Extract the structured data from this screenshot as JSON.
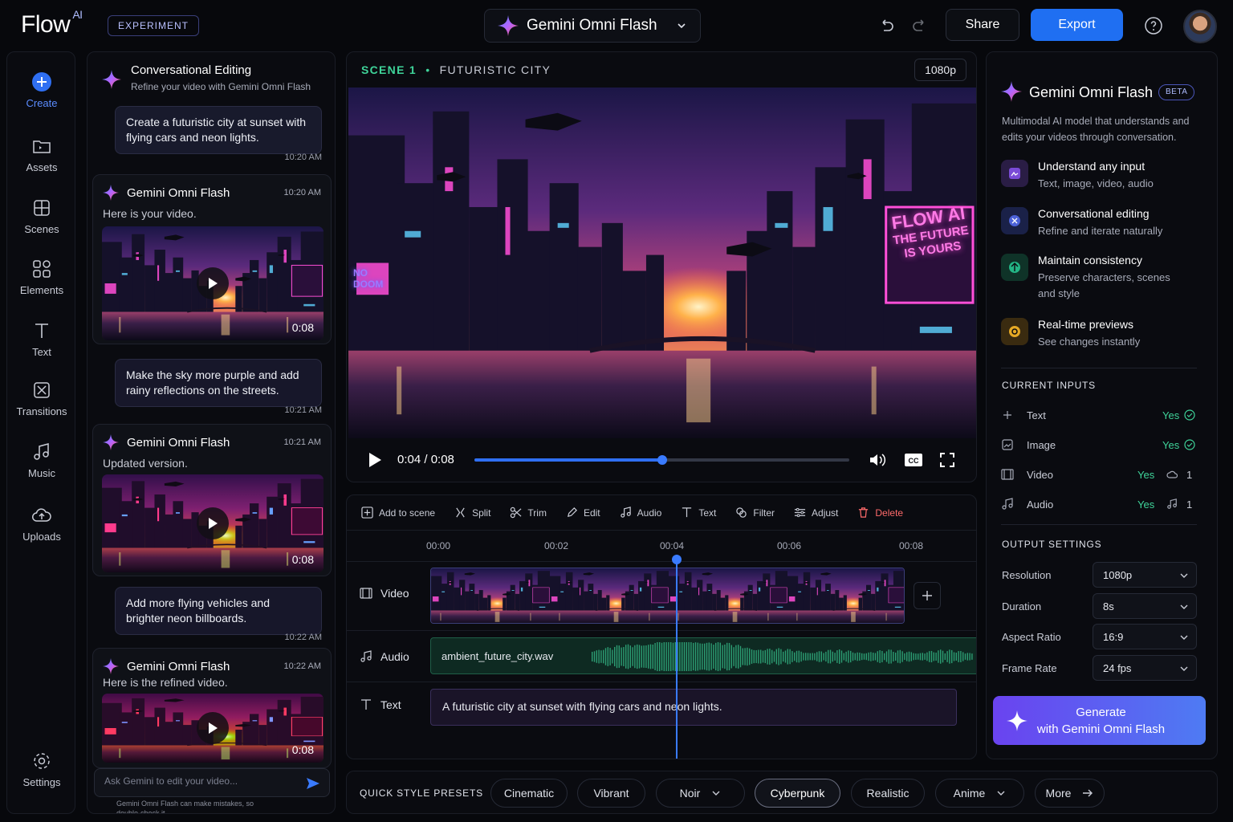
{
  "app": {
    "logo": "Flow",
    "logo_sup": "AI",
    "badge": "EXPERIMENT"
  },
  "header": {
    "model": "Gemini Omni Flash",
    "share": "Share",
    "export": "Export"
  },
  "rail": [
    {
      "label": "Create",
      "icon": "plus-circle-icon"
    },
    {
      "label": "Assets",
      "icon": "folder-icon"
    },
    {
      "label": "Scenes",
      "icon": "scenes-icon"
    },
    {
      "label": "Elements",
      "icon": "elements-icon"
    },
    {
      "label": "Text",
      "icon": "text-icon"
    },
    {
      "label": "Transitions",
      "icon": "transition-icon"
    },
    {
      "label": "Music",
      "icon": "music-icon"
    },
    {
      "label": "Uploads",
      "icon": "upload-cloud-icon"
    },
    {
      "label": "Settings",
      "icon": "gear-icon"
    }
  ],
  "chat": {
    "title": "Conversational Editing",
    "subtitle": "Refine your video with Gemini Omni Flash",
    "messages": [
      {
        "user": "Create a futuristic city at sunset with flying cars and neon lights.",
        "user_time": "10:20 AM",
        "ai_name": "Gemini Omni Flash",
        "ai_time": "10:20 AM",
        "ai_text": "Here is your video.",
        "duration": "0:08"
      },
      {
        "user": "Make the sky more purple and add rainy reflections on the streets.",
        "user_time": "10:21 AM",
        "ai_name": "Gemini Omni Flash",
        "ai_time": "10:21 AM",
        "ai_text": "Updated version.",
        "duration": "0:08"
      },
      {
        "user": "Add more flying vehicles and brighter neon billboards.",
        "user_time": "10:22 AM",
        "ai_name": "Gemini Omni Flash",
        "ai_time": "10:22 AM",
        "ai_text": "Here is the refined video.",
        "duration": "0:08"
      }
    ],
    "input_placeholder": "Ask Gemini to edit your video...",
    "disclaimer": "Gemini Omni Flash can make mistakes, so double-check it."
  },
  "preview": {
    "scene_num": "SCENE 1",
    "scene_sep": "•",
    "scene_name": "FUTURISTIC CITY",
    "resolution": "1080p",
    "time": "0:04 / 0:08",
    "progress": 0.5,
    "billboard_1": "FLOW AI",
    "billboard_2": "THE FUTURE",
    "billboard_3": "IS YOURS",
    "sign_left": "NO DOOM"
  },
  "toolbar": [
    "Add to scene",
    "Split",
    "Trim",
    "Edit",
    "Audio",
    "Text",
    "Filter",
    "Adjust",
    "Delete"
  ],
  "timeline": {
    "ticks": [
      "00:00",
      "00:02",
      "00:04",
      "00:06",
      "00:08"
    ],
    "tracks": {
      "video": "Video",
      "audio": "Audio",
      "text": "Text"
    },
    "audio_file": "ambient_future_city.wav",
    "text_clip": "A futuristic city at sunset with flying cars and neon lights.",
    "playhead": 0.5
  },
  "presets": {
    "label": "QUICK STYLE PRESETS",
    "items": [
      "Cinematic",
      "Vibrant",
      "Noir",
      "Cyberpunk",
      "Realistic",
      "Anime",
      "More"
    ],
    "selected": "Cyberpunk"
  },
  "panel": {
    "title": "Gemini Omni Flash",
    "beta": "BETA",
    "desc": "Multimodal AI model that understands and edits your videos through conversation.",
    "features": [
      {
        "title": "Understand any input",
        "desc": "Text, image, video, audio",
        "color": "#7a4bd6"
      },
      {
        "title": "Conversational editing",
        "desc": "Refine and iterate naturally",
        "color": "#4c62d9"
      },
      {
        "title": "Maintain consistency",
        "desc": "Preserve characters, scenes and style",
        "color": "#23b585"
      },
      {
        "title": "Real-time previews",
        "desc": "See changes instantly",
        "color": "#e6a925"
      }
    ],
    "inputs_title": "CURRENT INPUTS",
    "inputs": [
      {
        "name": "Text",
        "value": "Yes",
        "count": ""
      },
      {
        "name": "Image",
        "value": "Yes",
        "count": ""
      },
      {
        "name": "Video",
        "value": "Yes",
        "count": "1"
      },
      {
        "name": "Audio",
        "value": "Yes",
        "count": "1"
      }
    ],
    "output_title": "OUTPUT SETTINGS",
    "outputs": [
      {
        "name": "Resolution",
        "value": "1080p"
      },
      {
        "name": "Duration",
        "value": "8s"
      },
      {
        "name": "Aspect Ratio",
        "value": "16:9"
      },
      {
        "name": "Frame Rate",
        "value": "24 fps"
      }
    ],
    "generate_1": "Generate",
    "generate_2": "with Gemini Omni Flash"
  },
  "colors": {
    "accent": "#1f6ff2",
    "scene_green": "#3fd49a",
    "yes_green": "#3fd49a",
    "purple": "#6a43f0"
  }
}
